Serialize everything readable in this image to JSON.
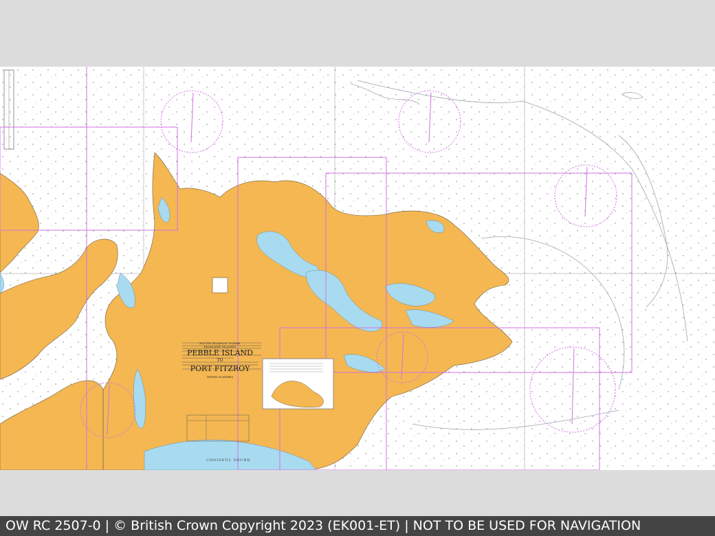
{
  "chart": {
    "region": "SOUTH ATLANTIC OCEAN",
    "subregion": "FALKLAND ISLANDS",
    "title_line1": "PEBBLE ISLAND",
    "title_to": "TO",
    "title_line2": "PORT FITZROY",
    "depths_note": "DEPTHS IN METRES"
  },
  "labels": {
    "choiseul_sound": "CHOISEUL SOUND"
  },
  "colors": {
    "land": "#f4b752",
    "water_shallow": "#a8dbf0",
    "sea": "#ffffff",
    "limits": "#d070e0",
    "footer_bg": "#444444"
  },
  "footer": {
    "text": "OW RC 2507-0 | © British Crown Copyright 2023 (EK001-ET) | NOT TO BE USED FOR NAVIGATION"
  }
}
